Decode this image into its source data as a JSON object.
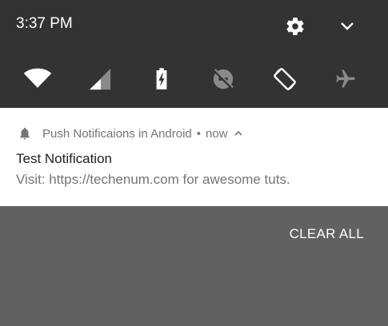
{
  "status_bar": {
    "time": "3:37 PM",
    "settings_icon": "gear-icon",
    "expand_icon": "chevron-down-icon"
  },
  "quick_settings": {
    "tiles": [
      {
        "icon": "wifi-icon",
        "state": "on"
      },
      {
        "icon": "cellular-signal-icon",
        "state": "partial"
      },
      {
        "icon": "battery-charging-icon",
        "state": "on"
      },
      {
        "icon": "do-not-disturb-off-icon",
        "state": "off"
      },
      {
        "icon": "auto-rotate-icon",
        "state": "on"
      },
      {
        "icon": "airplane-mode-icon",
        "state": "off"
      }
    ]
  },
  "notification": {
    "icon": "bell-icon",
    "app_name": "Push Notificaions in Android",
    "separator": "•",
    "time": "now",
    "title": "Test Notification",
    "body": "Visit: https://techenum.com for awesome tuts."
  },
  "actions": {
    "clear_all": "CLEAR ALL"
  },
  "colors": {
    "shade_bg": "#333333",
    "card_bg": "#ffffff",
    "scrim_bg": "#616161",
    "icon_on": "#ffffff",
    "icon_off": "#8a8a8a"
  }
}
